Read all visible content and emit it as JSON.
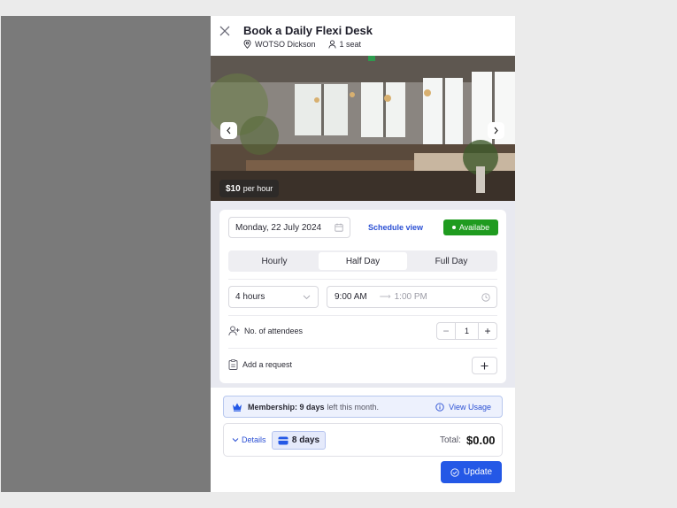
{
  "header": {
    "close_icon": "close-icon",
    "title": "Book a Daily Flexi Desk",
    "location": "WOTSO Dickson",
    "seats": "1 seat"
  },
  "hero": {
    "price": "$10",
    "price_unit": "per hour",
    "prev_icon": "chevron-left-icon",
    "next_icon": "chevron-right-icon"
  },
  "booking": {
    "date": "Monday, 22 July 2024",
    "schedule_link": "Schedule view",
    "status": "Availabe",
    "status_color": "#1f9b1f",
    "tabs": [
      {
        "label": "Hourly"
      },
      {
        "label": "Half Day"
      },
      {
        "label": "Full Day"
      }
    ],
    "active_tab": "Half Day",
    "duration": "4 hours",
    "start_time": "9:00 AM",
    "end_time": "1:00 PM",
    "attendees_label": "No. of attendees",
    "attendees_count": "1",
    "request_label": "Add a request"
  },
  "membership": {
    "label": "Membership: 9 days",
    "suffix": "left this month.",
    "view_usage": "View Usage"
  },
  "summary": {
    "details_label": "Details",
    "days": "8 days",
    "total_label": "Total:",
    "total_value": "$0.00"
  },
  "actions": {
    "update_label": "Update",
    "accent_color": "#2458e6"
  }
}
